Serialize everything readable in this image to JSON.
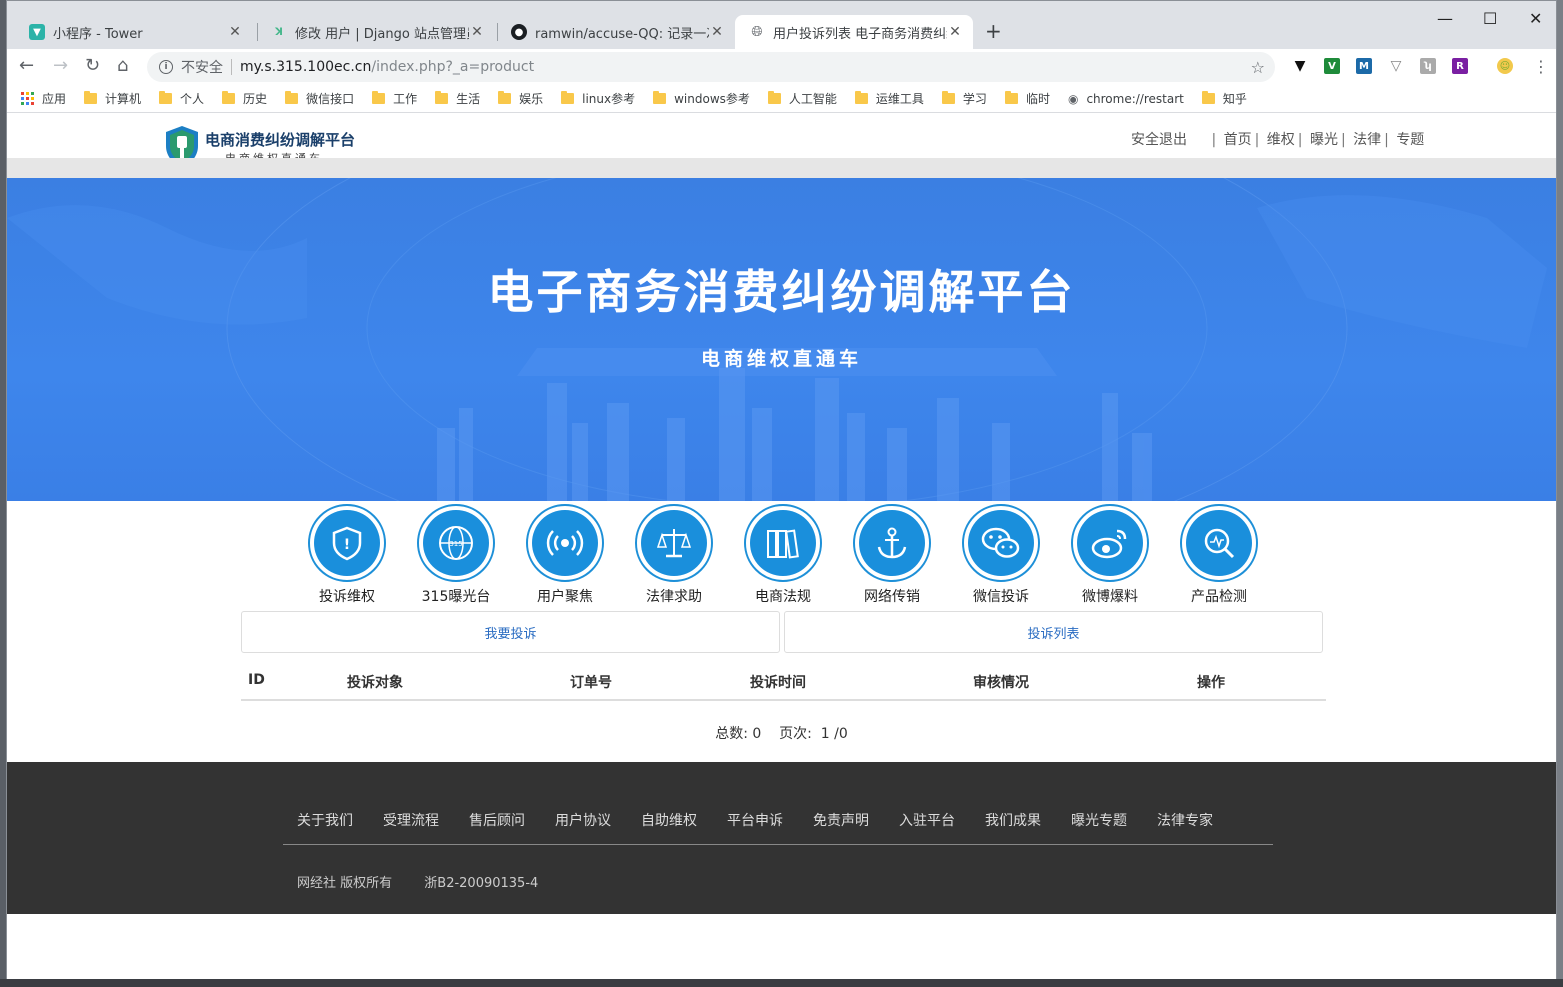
{
  "browser": {
    "tabs": [
      {
        "title": "小程序 - Tower",
        "icon": "tower-icon",
        "active": false
      },
      {
        "title": "修改 用户 | Django 站点管理员",
        "icon": "django-icon",
        "active": false
      },
      {
        "title": "ramwin/accuse-QQ: 记录一次找",
        "icon": "github-icon",
        "active": false
      },
      {
        "title": "用户投诉列表 电子商务消费纠纷",
        "icon": "globe-icon",
        "active": true
      }
    ],
    "new_tab": "+",
    "address": {
      "security": "不安全",
      "host": "my.s.315.100ec.cn",
      "path": "/index.php?_a=product"
    },
    "bookmarks": [
      "应用",
      "计算机",
      "个人",
      "历史",
      "微信接口",
      "工作",
      "生活",
      "娱乐",
      "linux参考",
      "windows参考",
      "人工智能",
      "运维工具",
      "学习",
      "临时",
      "chrome://restart",
      "知乎"
    ]
  },
  "site": {
    "logo_title": "电商消费纠纷调解平台",
    "logo_sub": "电商维权直通车",
    "logout": "安全退出",
    "nav": [
      "首页",
      "维权",
      "曝光",
      "法律",
      "专题"
    ],
    "hero_title": "电子商务消费纠纷调解平台",
    "hero_sub": "电商维权直通车",
    "services": [
      {
        "label": "投诉维权",
        "icon": "shield-icon"
      },
      {
        "label": "315曝光台",
        "icon": "globe-315-icon"
      },
      {
        "label": "用户聚焦",
        "icon": "broadcast-icon"
      },
      {
        "label": "法律求助",
        "icon": "scales-icon"
      },
      {
        "label": "电商法规",
        "icon": "books-icon"
      },
      {
        "label": "网络传销",
        "icon": "anchor-icon"
      },
      {
        "label": "微信投诉",
        "icon": "wechat-icon"
      },
      {
        "label": "微博爆料",
        "icon": "weibo-icon"
      },
      {
        "label": "产品检测",
        "icon": "magnifier-icon"
      }
    ],
    "btn_complain": "我要投诉",
    "btn_list": "投诉列表",
    "table_headers": [
      "ID",
      "投诉对象",
      "订单号",
      "投诉时间",
      "审核情况",
      "操作"
    ],
    "pager_total_label": "总数:",
    "pager_total": "0",
    "pager_page_label": "页次:",
    "pager_page": "1 /0",
    "footer_links": [
      "关于我们",
      "受理流程",
      "售后顾问",
      "用户协议",
      "自助维权",
      "平台申诉",
      "免责声明",
      "入驻平台",
      "我们成果",
      "曝光专题",
      "法律专家"
    ],
    "copyright": "网经社 版权所有",
    "icp": "浙B2-20090135-4"
  },
  "colors": {
    "hero_blue": "#3e86ec",
    "icon_blue": "#1a8fdc",
    "footer_bg": "#333333",
    "link_blue": "#2a6cc2"
  }
}
